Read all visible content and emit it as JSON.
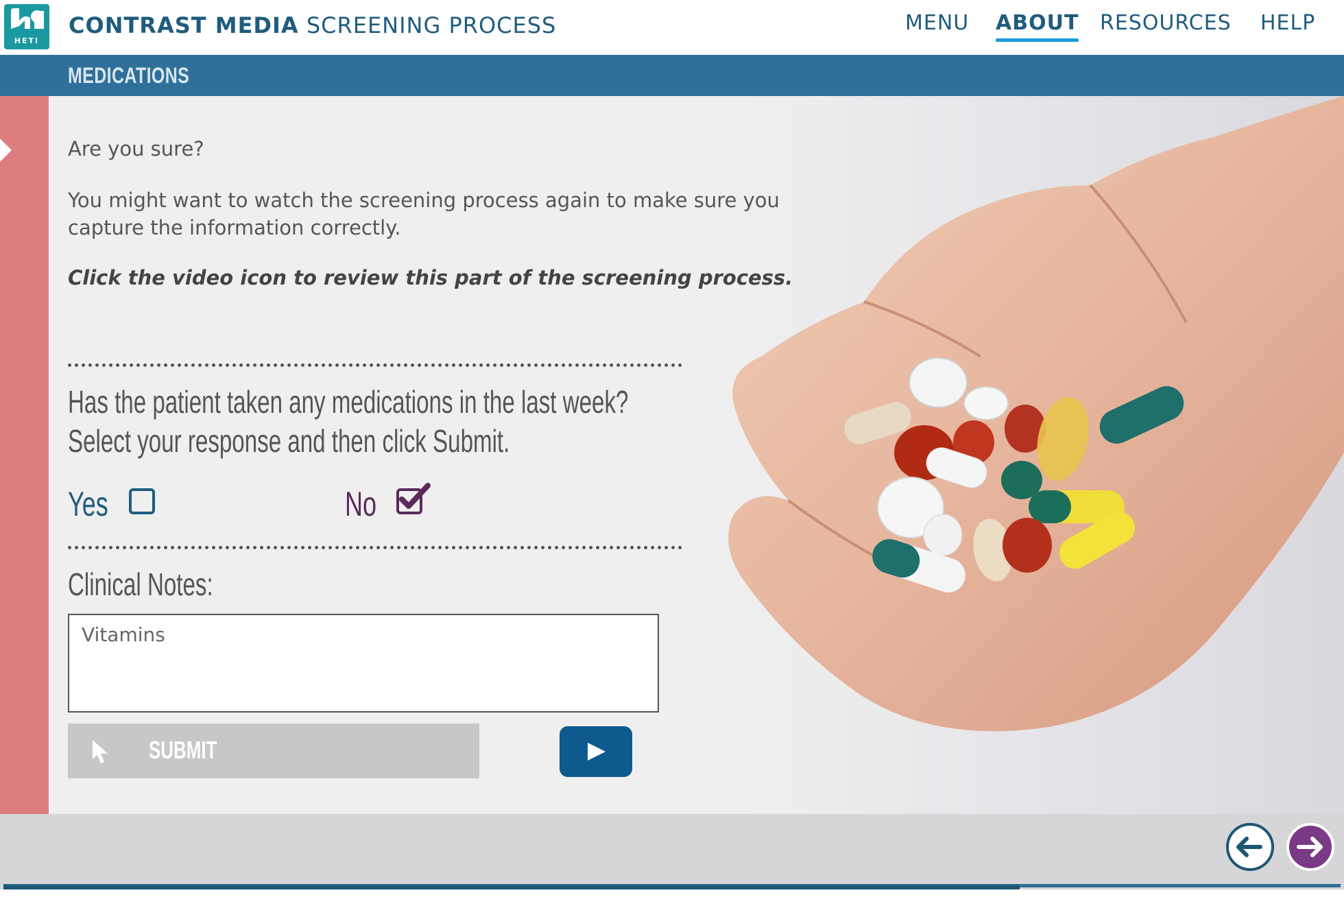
{
  "header": {
    "logo_text": "HETI",
    "title_strong": "CONTRAST MEDIA",
    "title_rest": "SCREENING PROCESS",
    "nav": {
      "menu": "MENU",
      "about": "ABOUT",
      "resources": "RESOURCES",
      "help": "HELP"
    }
  },
  "section": {
    "title": "MEDICATIONS"
  },
  "content": {
    "prompt_sure": "Are you sure?",
    "advice": "You might want to watch the screening process again to make sure you capture the information correctly.",
    "instruction": "Click the video icon to review this part of the screening process.",
    "question_line1": "Has the patient taken any medications in the last week?",
    "question_line2": "Select your response and then click Submit.",
    "options": {
      "yes": {
        "label": "Yes",
        "checked": false
      },
      "no": {
        "label": "No",
        "checked": true
      }
    },
    "notes_label": "Clinical Notes:",
    "notes_value": "Vitamins",
    "submit_label": "SUBMIT"
  },
  "colors": {
    "brand_blue": "#1f5c7e",
    "section_bar": "#2e7099",
    "left_strip": "#dd7d7f",
    "yes_color": "#1f5c7e",
    "no_color": "#5a2a5c",
    "video_button": "#0e5a8e",
    "next_button": "#7a3a86"
  },
  "icons": {
    "logo": "heti-logo-icon",
    "cursor": "cursor-icon",
    "video": "play-icon",
    "back": "arrow-left-icon",
    "next": "arrow-right-icon"
  },
  "progress": {
    "fraction": 0.76
  }
}
